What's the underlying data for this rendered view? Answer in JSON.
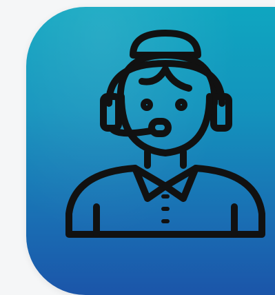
{
  "icon": {
    "name": "customer-support-agent-icon",
    "colors": {
      "background": "#f5f6f7",
      "tile_top": "#0fa6c0",
      "tile_bottom": "#1b55a9",
      "line": "#111111"
    }
  }
}
